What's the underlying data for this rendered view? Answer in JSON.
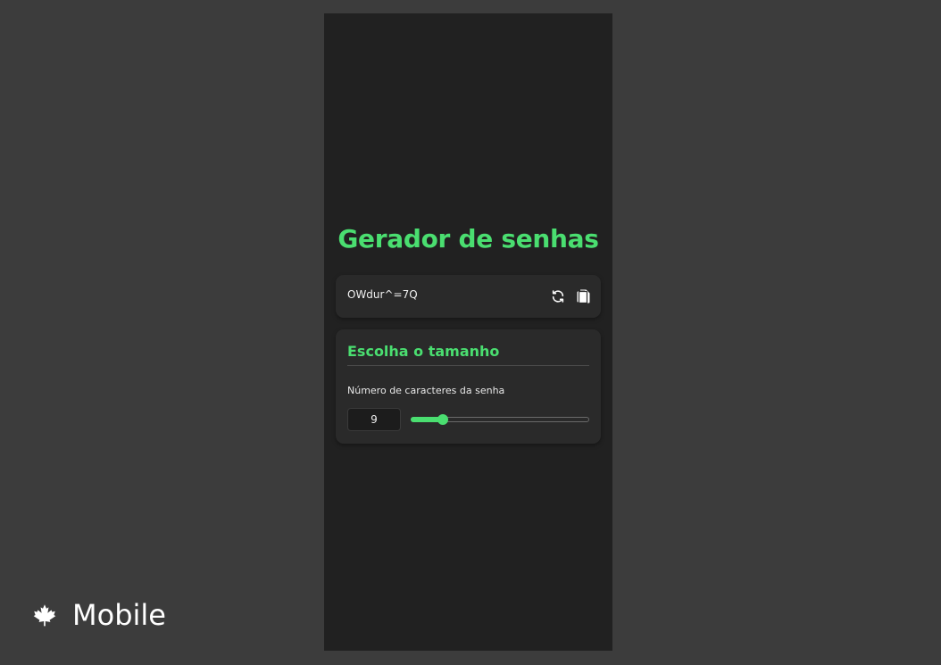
{
  "colors": {
    "background": "#3c3c3c",
    "panel": "#212121",
    "card": "#2a2a2a",
    "accent": "#4ade70"
  },
  "app": {
    "title": "Gerador de senhas"
  },
  "password": {
    "value": "OWdur^=7Q",
    "refresh_icon": "refresh-icon",
    "copy_icon": "copy-icon"
  },
  "length_section": {
    "heading": "Escolha o tamanho",
    "label": "Número de caracteres da senha",
    "value": "9",
    "slider_fraction": 0.18
  },
  "branding": {
    "icon": "maple-leaf-icon",
    "label": "Mobile"
  }
}
